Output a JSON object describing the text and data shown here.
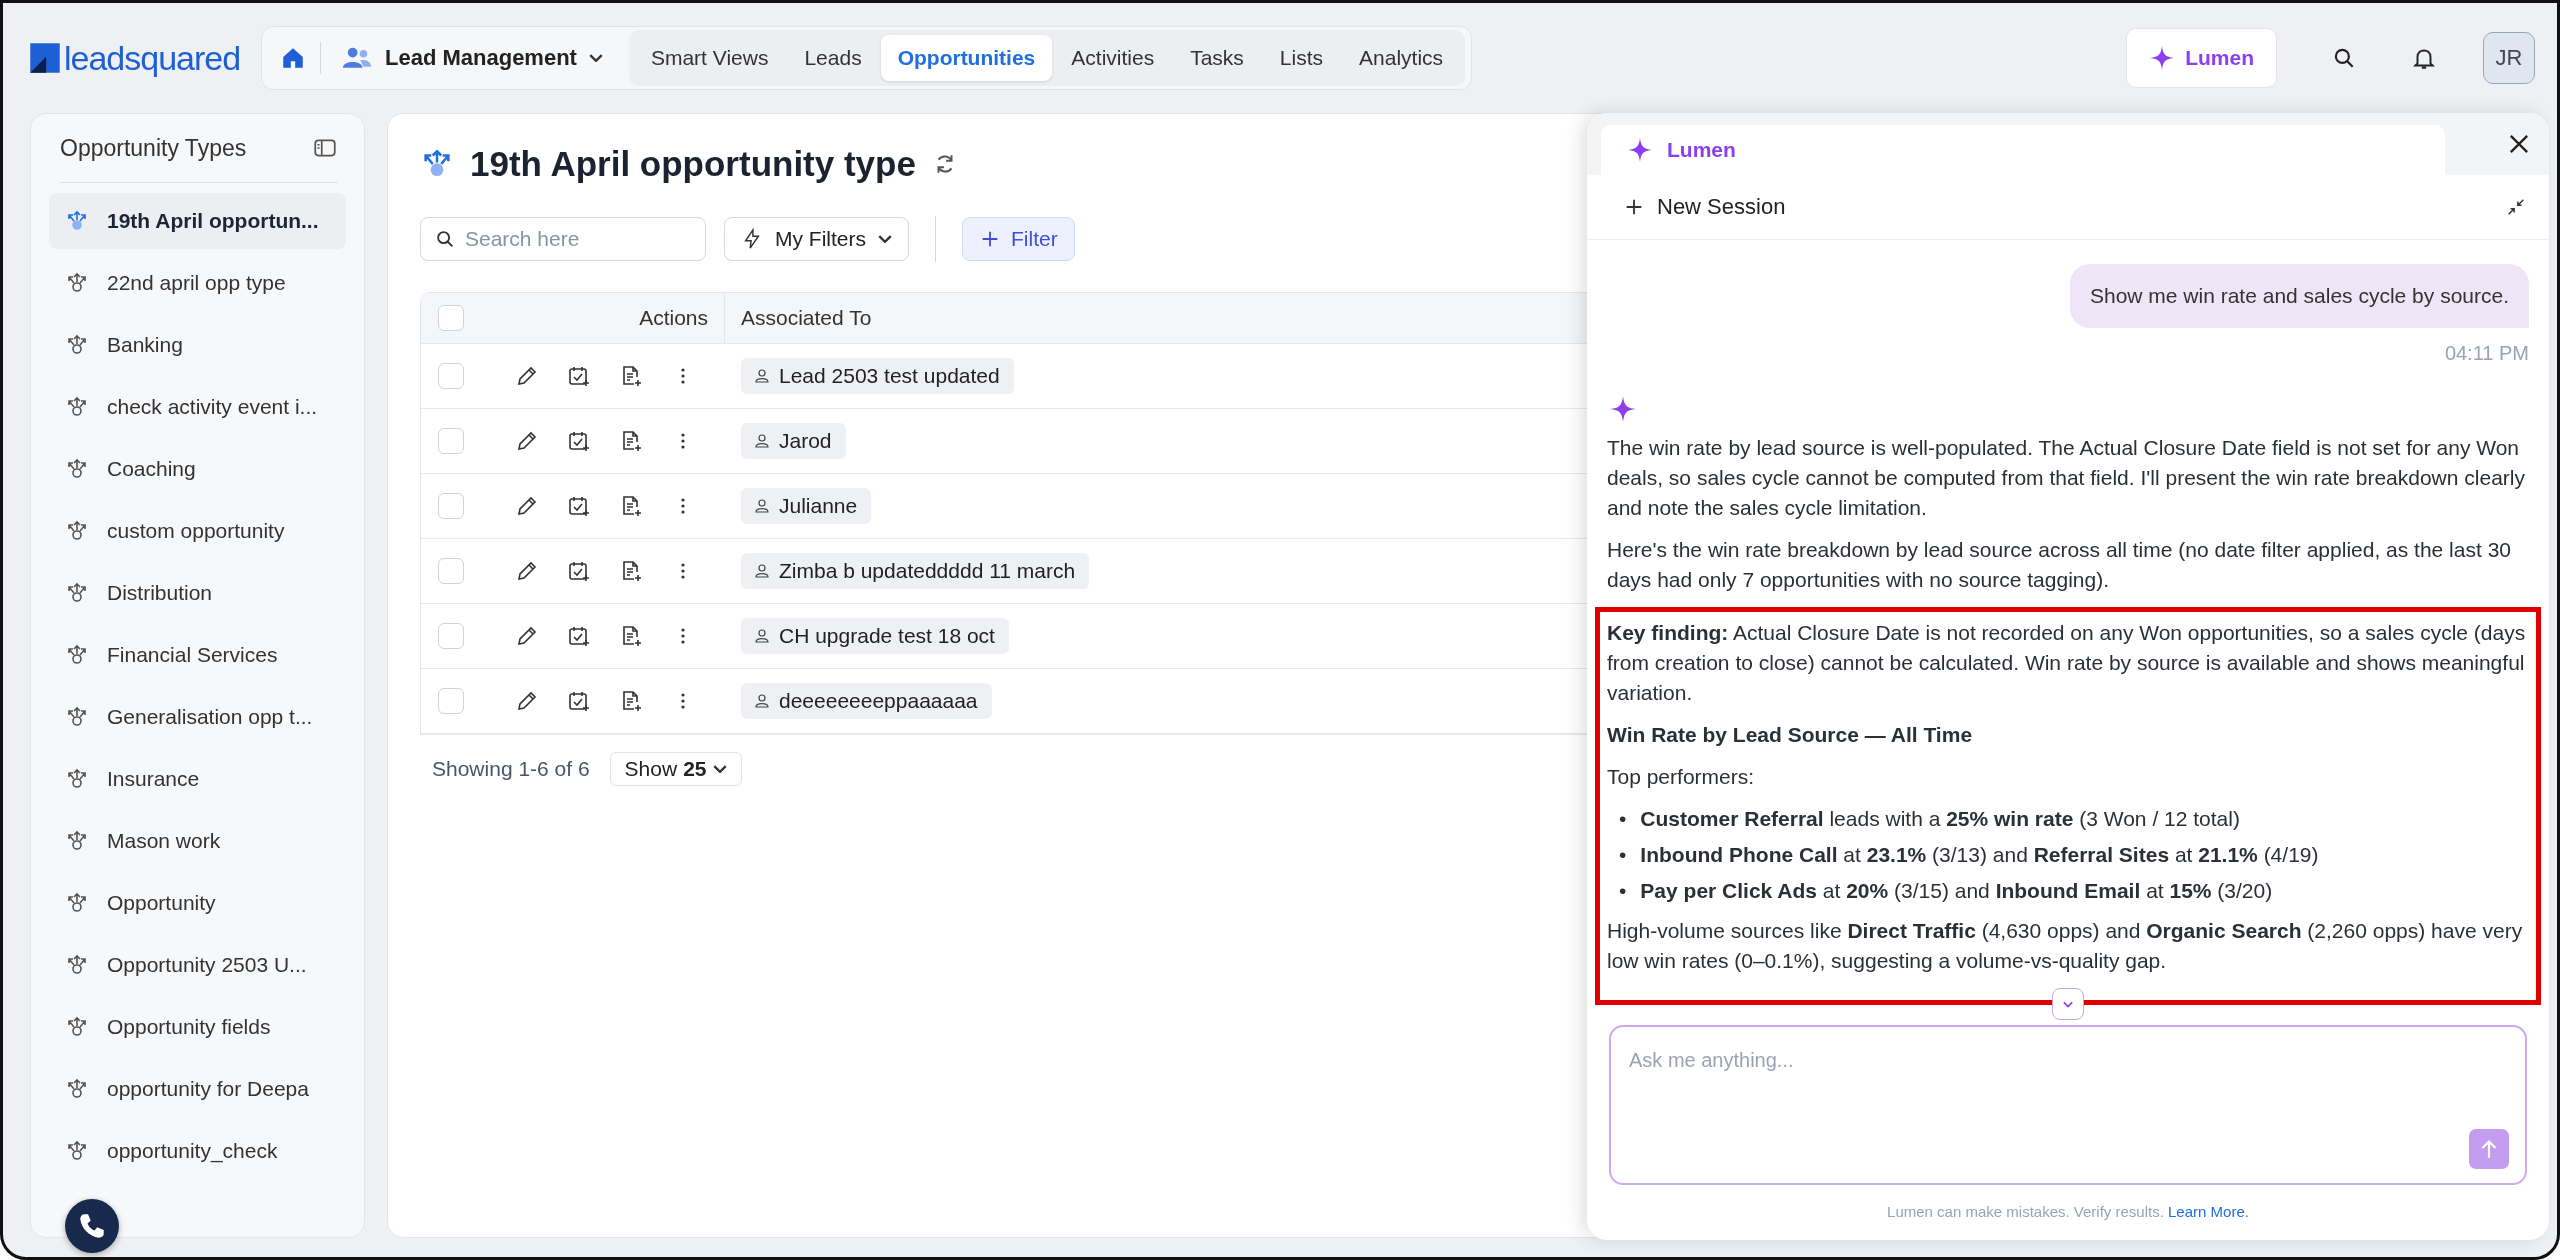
{
  "brand": {
    "logo_text": "leadsquared"
  },
  "nav": {
    "module": "Lead Management",
    "tabs": [
      {
        "label": "Smart Views",
        "selected": false
      },
      {
        "label": "Leads",
        "selected": false
      },
      {
        "label": "Opportunities",
        "selected": true
      },
      {
        "label": "Activities",
        "selected": false
      },
      {
        "label": "Tasks",
        "selected": false
      },
      {
        "label": "Lists",
        "selected": false
      },
      {
        "label": "Analytics",
        "selected": false
      }
    ]
  },
  "header_actions": {
    "lumen_button": "Lumen",
    "avatar": "JR"
  },
  "sidebar": {
    "title": "Opportunity Types",
    "items": [
      {
        "label": "19th April opportun...",
        "selected": true
      },
      {
        "label": "22nd april opp type",
        "selected": false
      },
      {
        "label": "Banking",
        "selected": false
      },
      {
        "label": "check activity event i...",
        "selected": false
      },
      {
        "label": "Coaching",
        "selected": false
      },
      {
        "label": "custom opportunity",
        "selected": false
      },
      {
        "label": "Distribution",
        "selected": false
      },
      {
        "label": "Financial Services",
        "selected": false
      },
      {
        "label": "Generalisation opp t...",
        "selected": false
      },
      {
        "label": "Insurance",
        "selected": false
      },
      {
        "label": "Mason work",
        "selected": false
      },
      {
        "label": "Opportunity",
        "selected": false
      },
      {
        "label": "Opportunity 2503 U...",
        "selected": false
      },
      {
        "label": "Opportunity fields",
        "selected": false
      },
      {
        "label": "opportunity for Deepa",
        "selected": false
      },
      {
        "label": "opportunity_check",
        "selected": false
      }
    ]
  },
  "page": {
    "title": "19th April opportunity type",
    "search": {
      "placeholder": "Search here"
    },
    "my_filters": "My Filters",
    "filter_button": "Filter"
  },
  "table": {
    "columns": [
      "Actions",
      "Associated To"
    ],
    "all_checked": false,
    "rows": [
      {
        "associated_to": "Lead 2503 test updated",
        "checked": false
      },
      {
        "associated_to": "Jarod",
        "checked": false
      },
      {
        "associated_to": "Julianne",
        "checked": false
      },
      {
        "associated_to": "Zimba b updateddddd 11 march",
        "checked": false
      },
      {
        "associated_to": "CH upgrade test 18 oct",
        "checked": false
      },
      {
        "associated_to": "deeeeeeeeppaaaaaa",
        "checked": false
      }
    ]
  },
  "pagination": {
    "showing": "Showing 1-6 of 6",
    "show_label": "Show",
    "page_size": "25"
  },
  "lumen": {
    "title": "Lumen",
    "new_session": "New Session",
    "user_message": {
      "text": "Show me win rate and sales cycle by source.",
      "time": "04:11 PM"
    },
    "assistant_blocks": [
      {
        "kind": "paragraph",
        "text": "The win rate by lead source is well-populated. The Actual Closure Date field is not set for any Won deals, so sales cycle cannot be computed from that field. I'll present the win rate breakdown clearly and note the sales cycle limitation."
      },
      {
        "kind": "paragraph",
        "text": "Here's the win rate breakdown by lead source across all time (no date filter applied, as the last 30 days had only 7 opportunities with no source tagging)."
      }
    ],
    "highlighted_blocks": [
      {
        "kind": "paragraph",
        "text": "**Key finding:** Actual Closure Date is not recorded on any Won opportunities, so a sales cycle (days from creation to close) cannot be calculated. Win rate by source is available and shows meaningful variation."
      },
      {
        "kind": "heading",
        "text": "Win Rate by Lead Source — All Time"
      },
      {
        "kind": "paragraph",
        "text": "Top performers:"
      },
      {
        "kind": "bullets",
        "marker": "•",
        "items": [
          "**Customer Referral** leads with a **25% win rate** (3 Won / 12 total)",
          "**Inbound Phone Call** at **23.1%** (3/13) and **Referral Sites** at **21.1%** (4/19)",
          "**Pay per Click Ads** at **20%** (3/15) and **Inbound Email** at **15%** (3/20)"
        ]
      },
      {
        "kind": "paragraph",
        "text": "High-volume sources like **Direct Traffic** (4,630 opps) and **Organic Search** (2,260 opps) have very low win rates (0–0.1%), suggesting a volume-vs-quality gap."
      }
    ],
    "input": {
      "placeholder": "Ask me anything..."
    },
    "disclaimer": "Lumen can make mistakes. Verify results.",
    "learn_more": "Learn More."
  }
}
